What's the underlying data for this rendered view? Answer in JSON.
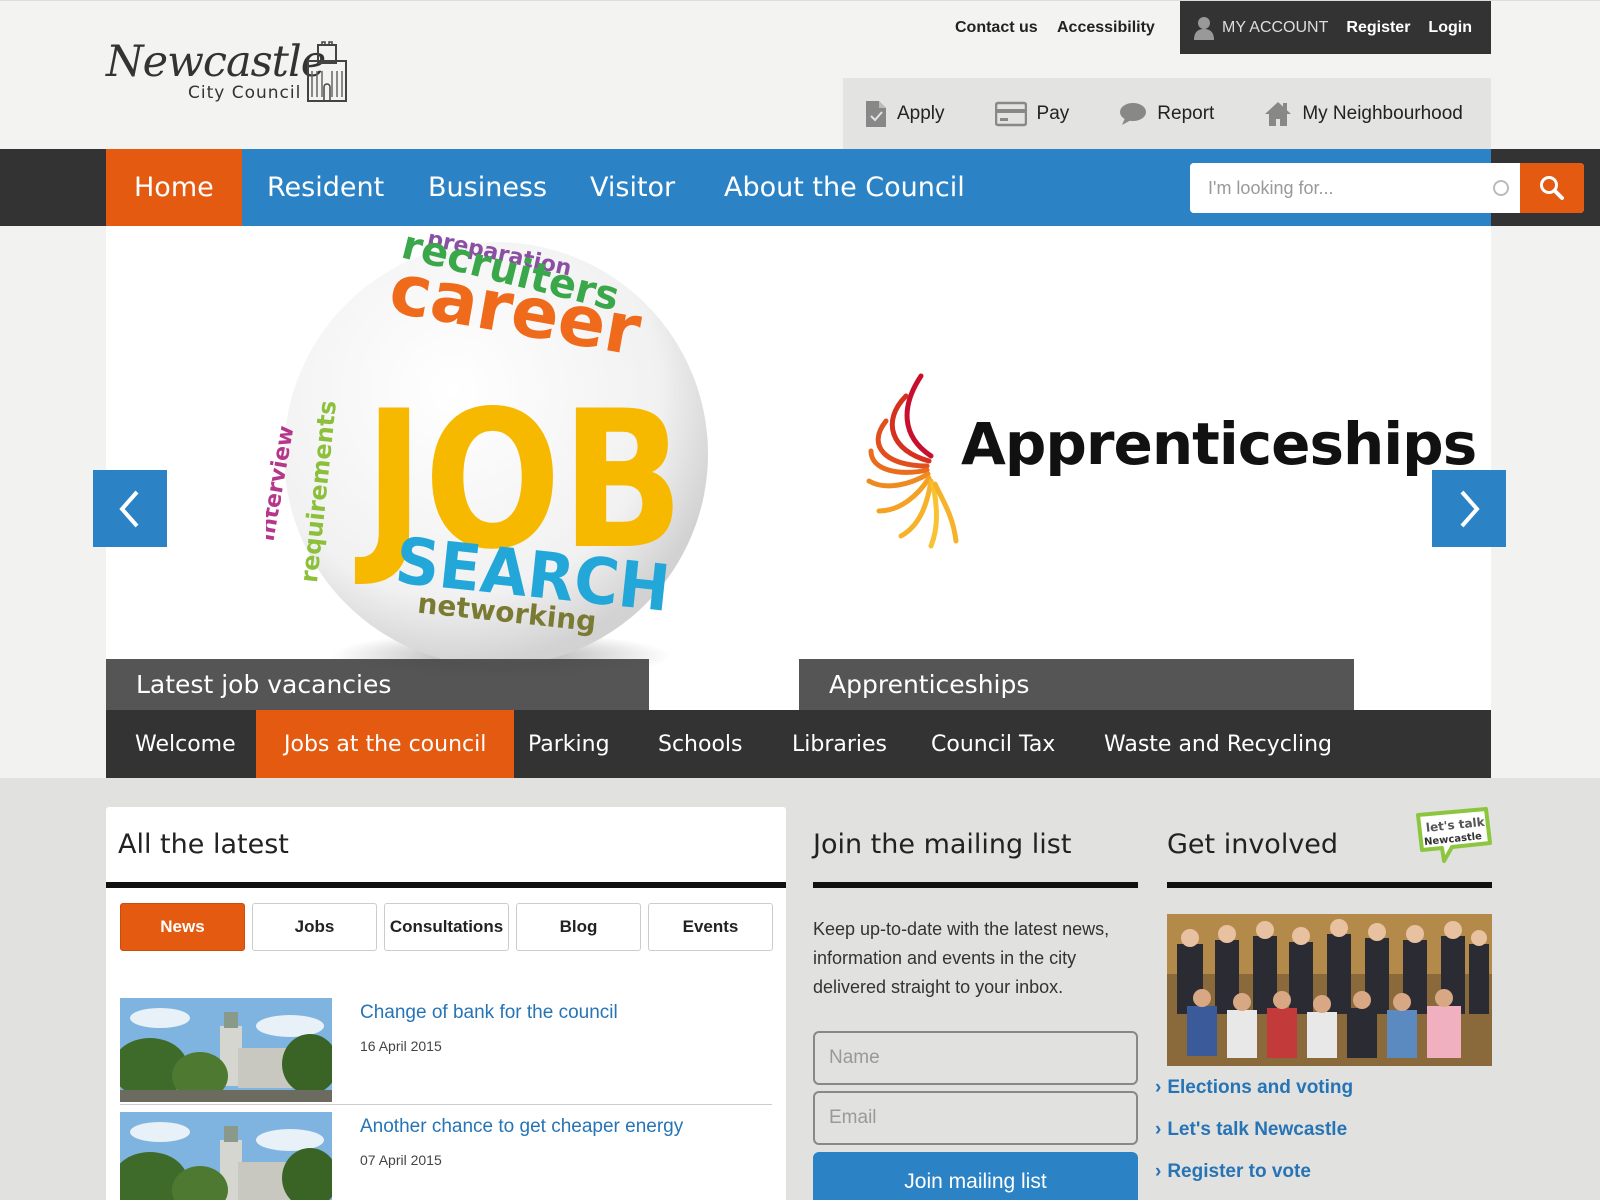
{
  "header": {
    "logo_word": "Newcastle",
    "logo_sub": "City Council",
    "contact": "Contact us",
    "accessibility": "Accessibility",
    "my_account": "MY ACCOUNT",
    "register": "Register",
    "login": "Login"
  },
  "services": [
    {
      "label": "Apply",
      "icon": "document-icon"
    },
    {
      "label": "Pay",
      "icon": "card-icon"
    },
    {
      "label": "Report",
      "icon": "speech-bubble-icon"
    },
    {
      "label": "My Neighbourhood",
      "icon": "house-icon"
    }
  ],
  "nav": {
    "items": [
      "Home",
      "Resident",
      "Business",
      "Visitor",
      "About the Council"
    ],
    "active": "Home",
    "search_placeholder": "I'm looking for..."
  },
  "carousel": {
    "slides": [
      {
        "caption": "Latest job vacancies",
        "words": [
          "preparation",
          "recruiters",
          "career",
          "interview",
          "requirements",
          "JOB",
          "SEARCH",
          "networking"
        ]
      },
      {
        "caption": "Apprenticeships",
        "heading": "Apprenticeships"
      }
    ]
  },
  "subnav": {
    "items": [
      "Welcome",
      "Jobs at the council",
      "Parking",
      "Schools",
      "Libraries",
      "Council Tax",
      "Waste and Recycling"
    ],
    "active": "Jobs at the council"
  },
  "latest": {
    "title": "All the latest",
    "tabs": [
      "News",
      "Jobs",
      "Consultations",
      "Blog",
      "Events"
    ],
    "active_tab": "News",
    "items": [
      {
        "title": "Change of bank for the council",
        "date": "16 April 2015"
      },
      {
        "title": "Another chance to get cheaper energy",
        "date": "07 April 2015"
      }
    ]
  },
  "mailing": {
    "title": "Join the mailing list",
    "text": "Keep up-to-date with the latest news, information and events in the city delivered straight to your inbox.",
    "name_placeholder": "Name",
    "email_placeholder": "Email",
    "button": "Join mailing list"
  },
  "involved": {
    "title": "Get involved",
    "badge_line1": "let's talk",
    "badge_line2": "Newcastle",
    "links": [
      "Elections and voting",
      "Let's talk Newcastle",
      "Register to vote"
    ]
  },
  "colors": {
    "accent_orange": "#e35a10",
    "nav_blue": "#2b83c6",
    "link_blue": "#2674b6",
    "dark": "#333333"
  }
}
